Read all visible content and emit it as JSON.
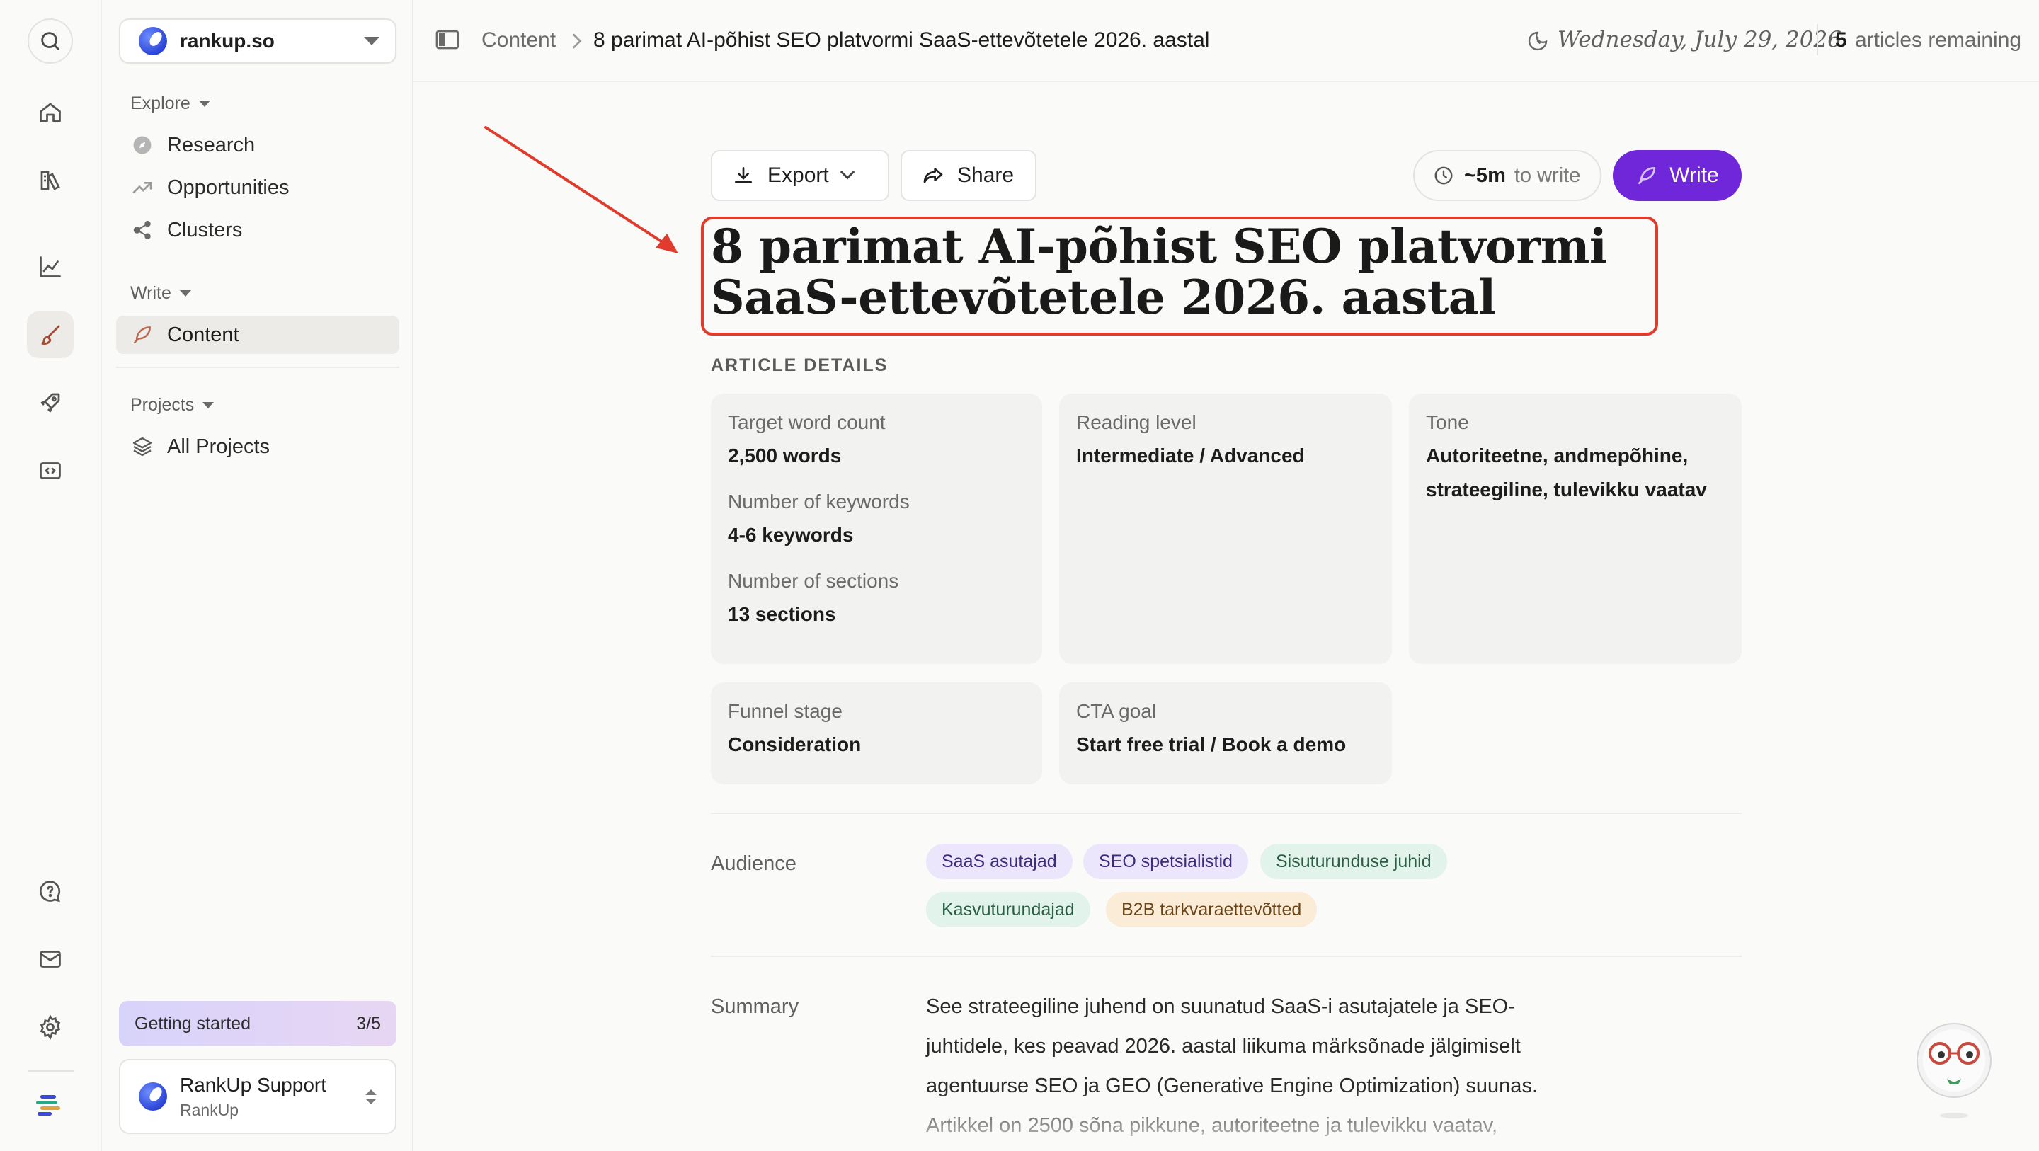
{
  "workspace": {
    "name": "rankup.so"
  },
  "sidebar": {
    "explore": {
      "label": "Explore",
      "items": [
        {
          "label": "Research"
        },
        {
          "label": "Opportunities"
        },
        {
          "label": "Clusters"
        }
      ]
    },
    "write": {
      "label": "Write",
      "items": [
        {
          "label": "Content"
        }
      ]
    },
    "projects": {
      "label": "Projects",
      "items": [
        {
          "label": "All Projects"
        }
      ]
    },
    "getting_started": {
      "label": "Getting started",
      "progress": "3/5"
    },
    "support": {
      "name": "RankUp Support",
      "org": "RankUp"
    }
  },
  "header": {
    "breadcrumb_root": "Content",
    "breadcrumb_current": "8 parimat AI-põhist SEO platvormi SaaS-ettevõtetele 2026. aastal",
    "date": "Wednesday, July 29, 2026",
    "articles_count": "5",
    "articles_remaining_label": "articles remaining"
  },
  "toolbar": {
    "export_label": "Export",
    "share_label": "Share",
    "time_value": "~5m",
    "time_unit": "to write",
    "write_label": "Write"
  },
  "article": {
    "title": "8 parimat AI-põhist SEO platvormi SaaS-ettevõtetele 2026. aastal",
    "details_heading": "ARTICLE DETAILS",
    "details": {
      "target_word_count": {
        "label": "Target word count",
        "value": "2,500 words"
      },
      "number_of_keywords": {
        "label": "Number of keywords",
        "value": "4-6 keywords"
      },
      "number_of_sections": {
        "label": "Number of sections",
        "value": "13 sections"
      },
      "reading_level": {
        "label": "Reading level",
        "value": "Intermediate / Advanced"
      },
      "tone": {
        "label": "Tone",
        "value": "Autoriteetne, andmepõhine, strateegiline, tulevikku vaatav"
      },
      "funnel_stage": {
        "label": "Funnel stage",
        "value": "Consideration"
      },
      "cta_goal": {
        "label": "CTA goal",
        "value": "Start free trial / Book a demo"
      }
    },
    "audience_label": "Audience",
    "audience": [
      {
        "label": "SaaS asutajad",
        "color": "#ebe6fb"
      },
      {
        "label": "SEO spetsialistid",
        "color": "#ebe6fb"
      },
      {
        "label": "Sisuturunduse juhid",
        "color": "#e1f3ea"
      },
      {
        "label": "Kasvuturundajad",
        "color": "#e1f3ea"
      },
      {
        "label": "B2B tarkvaraettevõtted",
        "color": "#fbecd8"
      }
    ],
    "summary_label": "Summary",
    "summary": "See strateegiline juhend on suunatud SaaS-i asutajatele ja SEO-juhtidele, kes peavad 2026. aastal liikuma märksõnade jälgimiselt agentuurse SEO ja GEO (Generative Engine Optimization) suunas. Artikkel on 2500 sõna pikkune, autoriteetne ja tulevikku vaatav,"
  },
  "colors": {
    "accent": "#7027d9",
    "annotation": "#e03b2c"
  }
}
